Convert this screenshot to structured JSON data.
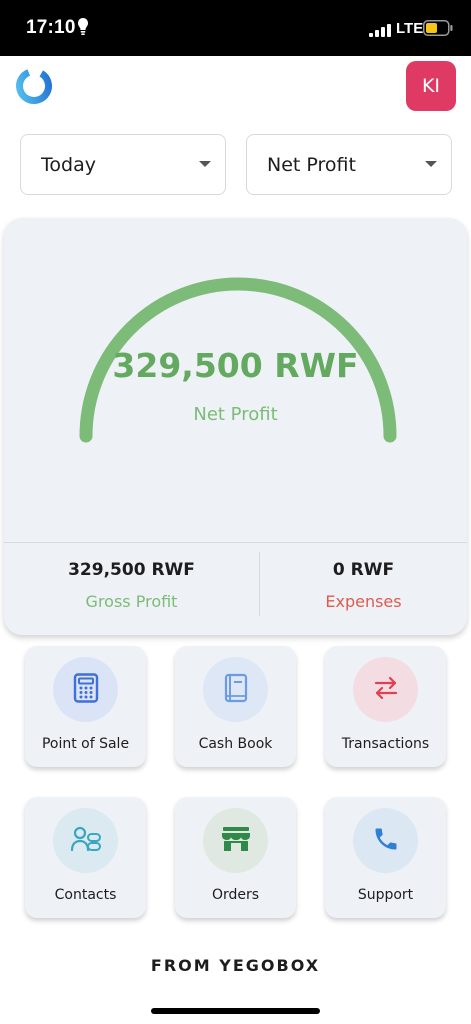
{
  "status_bar": {
    "time": "17:10",
    "network": "LTE",
    "bulb_icon": "lightbulb-icon",
    "signal_icon": "signal-icon",
    "battery_icon": "battery-icon",
    "battery_color": "#f5c518"
  },
  "header": {
    "logo_icon": "app-logo-ring-icon",
    "avatar_initials": "KI",
    "avatar_color": "#de3a64"
  },
  "filters": {
    "period": {
      "selected": "Today"
    },
    "metric": {
      "selected": "Net Profit"
    }
  },
  "profit_card": {
    "gauge_value": "329,500 RWF",
    "gauge_label": "Net Profit",
    "gauge_fill_fraction": 1.0,
    "gauge_color": "#7dbb78",
    "gross_profit": {
      "value": "329,500 RWF",
      "label": "Gross Profit"
    },
    "expenses": {
      "value": "0 RWF",
      "label": "Expenses"
    }
  },
  "actions": [
    {
      "label": "Point of Sale",
      "icon": "calculator-icon",
      "circle_color": "#dbe4f7",
      "icon_color": "#3f6fd8"
    },
    {
      "label": "Cash Book",
      "icon": "book-icon",
      "circle_color": "#dde7f5",
      "icon_color": "#6d9ae0"
    },
    {
      "label": "Transactions",
      "icon": "swap-arrows-icon",
      "circle_color": "#f3dde3",
      "icon_color": "#e0404f"
    },
    {
      "label": "Contacts",
      "icon": "contacts-icon",
      "circle_color": "#dbeaf0",
      "icon_color": "#3aa6c0"
    },
    {
      "label": "Orders",
      "icon": "store-icon",
      "circle_color": "#dfe9e1",
      "icon_color": "#2f8a4a"
    },
    {
      "label": "Support",
      "icon": "phone-icon",
      "circle_color": "#dbe7f3",
      "icon_color": "#2f7fd4"
    }
  ],
  "footer": {
    "text": "FROM YEGOBOX"
  }
}
